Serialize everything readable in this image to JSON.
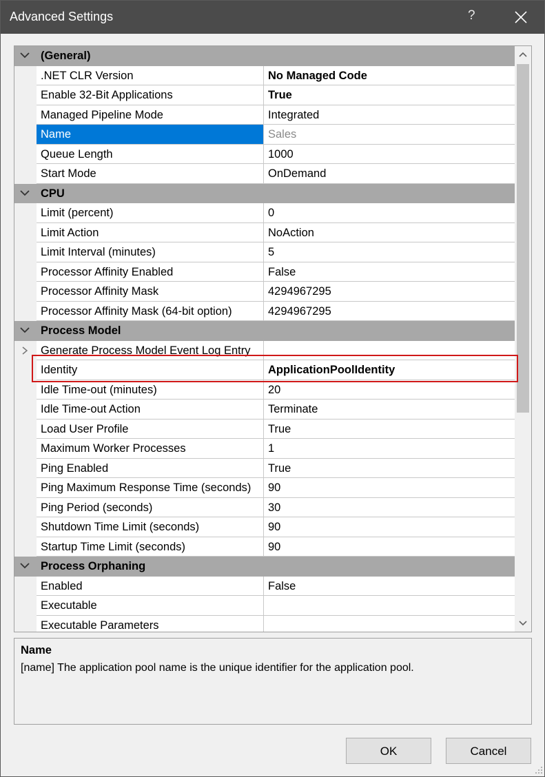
{
  "window": {
    "title": "Advanced Settings",
    "help": "?"
  },
  "categories": {
    "general": "(General)",
    "cpu": "CPU",
    "process_model": "Process Model",
    "process_orphaning": "Process Orphaning"
  },
  "properties": {
    "clr_version": {
      "name": ".NET CLR Version",
      "value": "No Managed Code"
    },
    "enable_32bit": {
      "name": "Enable 32-Bit Applications",
      "value": "True"
    },
    "pipeline_mode": {
      "name": "Managed Pipeline Mode",
      "value": "Integrated"
    },
    "name": {
      "name": "Name",
      "value": "Sales"
    },
    "queue_length": {
      "name": "Queue Length",
      "value": "1000"
    },
    "start_mode": {
      "name": "Start Mode",
      "value": "OnDemand"
    },
    "cpu_limit": {
      "name": "Limit (percent)",
      "value": "0"
    },
    "cpu_limit_action": {
      "name": "Limit Action",
      "value": "NoAction"
    },
    "cpu_limit_interval": {
      "name": "Limit Interval (minutes)",
      "value": "5"
    },
    "affinity_enabled": {
      "name": "Processor Affinity Enabled",
      "value": "False"
    },
    "affinity_mask": {
      "name": "Processor Affinity Mask",
      "value": "4294967295"
    },
    "affinity_mask64": {
      "name": "Processor Affinity Mask (64-bit option)",
      "value": "4294967295"
    },
    "gen_event_log": {
      "name": "Generate Process Model Event Log Entry",
      "value": ""
    },
    "identity": {
      "name": "Identity",
      "value": "ApplicationPoolIdentity"
    },
    "idle_timeout": {
      "name": "Idle Time-out (minutes)",
      "value": "20"
    },
    "idle_timeout_action": {
      "name": "Idle Time-out Action",
      "value": "Terminate"
    },
    "load_user_profile": {
      "name": "Load User Profile",
      "value": "True"
    },
    "max_worker": {
      "name": "Maximum Worker Processes",
      "value": "1"
    },
    "ping_enabled": {
      "name": "Ping Enabled",
      "value": "True"
    },
    "ping_max_response": {
      "name": "Ping Maximum Response Time (seconds)",
      "value": "90"
    },
    "ping_period": {
      "name": "Ping Period (seconds)",
      "value": "30"
    },
    "shutdown_limit": {
      "name": "Shutdown Time Limit (seconds)",
      "value": "90"
    },
    "startup_limit": {
      "name": "Startup Time Limit (seconds)",
      "value": "90"
    },
    "orphan_enabled": {
      "name": "Enabled",
      "value": "False"
    },
    "orphan_executable": {
      "name": "Executable",
      "value": ""
    },
    "orphan_exec_params": {
      "name": "Executable Parameters",
      "value": ""
    }
  },
  "description": {
    "title": "Name",
    "text": "[name] The application pool name is the unique identifier for the application pool."
  },
  "buttons": {
    "ok": "OK",
    "cancel": "Cancel"
  },
  "colors": {
    "selection": "#0078d7",
    "category": "#a8a8a8",
    "highlight": "#d01818",
    "titlebar": "#4b4b4b"
  }
}
